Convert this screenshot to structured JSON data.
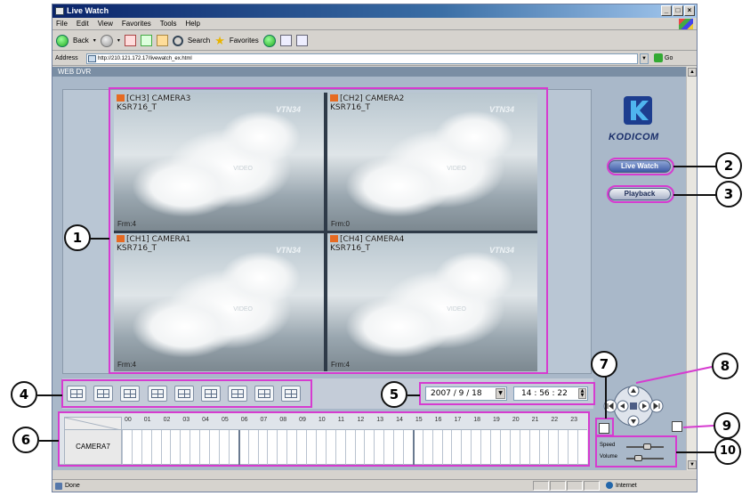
{
  "window": {
    "title": "Live Watch",
    "menu": [
      "File",
      "Edit",
      "View",
      "Favorites",
      "Tools",
      "Help"
    ],
    "toolbar": {
      "back_label": "Back",
      "search_label": "Search",
      "favorites_label": "Favorites"
    },
    "address_label": "Address",
    "address_value": "http://210.121.172.17/livewatch_ex.html",
    "go_label": "Go",
    "status_text": "Done",
    "zone_text": "Internet"
  },
  "dvr": {
    "header": "WEB DVR",
    "brand": "KODICOM",
    "buttons": {
      "live_watch": "Live Watch",
      "playback": "Playback"
    },
    "cameras": [
      {
        "title": "[CH3] CAMERA3",
        "subtitle": "KSR716_T",
        "watermark": "VTN34",
        "overlay": "VIDEO",
        "frame": "Frm:4"
      },
      {
        "title": "[CH2] CAMERA2",
        "subtitle": "KSR716_T",
        "watermark": "VTN34",
        "overlay": "VIDEO",
        "frame": "Frm:0"
      },
      {
        "title": "[CH1] CAMERA1",
        "subtitle": "KSR716_T",
        "watermark": "VTN34",
        "overlay": "VIDEO",
        "frame": "Frm:4"
      },
      {
        "title": "[CH4] CAMERA4",
        "subtitle": "KSR716_T",
        "watermark": "VTN34",
        "overlay": "VIDEO",
        "frame": "Frm:4"
      }
    ],
    "date": "2007 / 9 / 18",
    "time": "14 : 56 : 22",
    "timeline": {
      "camera": "CAMERA7",
      "hours": [
        "00",
        "01",
        "02",
        "03",
        "04",
        "05",
        "06",
        "07",
        "08",
        "09",
        "10",
        "11",
        "12",
        "13",
        "14",
        "15",
        "16",
        "17",
        "18",
        "19",
        "20",
        "21",
        "22",
        "23"
      ]
    },
    "sliders": {
      "speed_label": "Speed",
      "volume_label": "Volume",
      "speed": 0.55,
      "volume": 0.3
    }
  },
  "callouts": [
    "1",
    "2",
    "3",
    "4",
    "5",
    "6",
    "7",
    "8",
    "9",
    "10"
  ],
  "colors": {
    "highlight": "#d63bd0",
    "titlebar": "#0a246a",
    "panel": "#a9b8c9"
  }
}
